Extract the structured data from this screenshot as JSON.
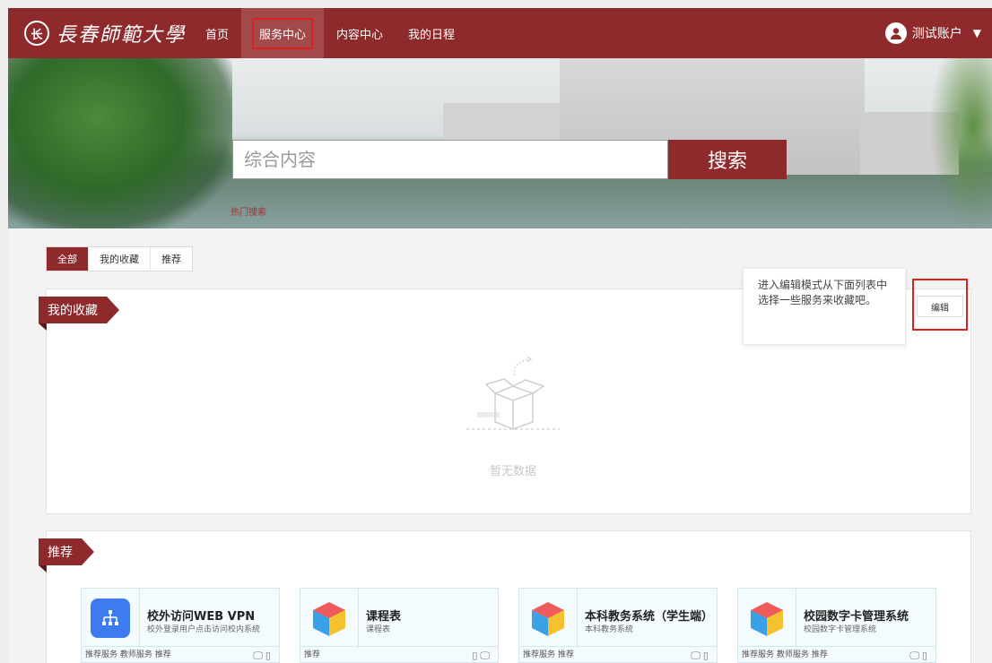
{
  "header": {
    "logo_text": "長春師範大學",
    "logo_seal": "长",
    "nav": [
      {
        "label": "首页"
      },
      {
        "label": "服务中心"
      },
      {
        "label": "内容中心"
      },
      {
        "label": "我的日程"
      }
    ],
    "user_name": "测试账户",
    "caret": "▼",
    "accent": "#8e2a2b"
  },
  "search": {
    "placeholder": "综合内容",
    "button_label": "搜索",
    "hot_label": "热门搜索"
  },
  "filter_tabs": [
    {
      "label": "全部"
    },
    {
      "label": "我的收藏"
    },
    {
      "label": "推荐"
    }
  ],
  "favorites": {
    "title": "我的收藏",
    "empty_text": "暂无数据",
    "tip_text": "进入编辑模式从下面列表中选择一些服务来收藏吧。",
    "edit_label": "编辑"
  },
  "recommend": {
    "title": "推荐",
    "cards": [
      {
        "title": "校外访问WEB VPN",
        "subtitle": "校外登录用户点击访问校内系统",
        "tags": "推荐服务 教师服务 推荐",
        "devices": "🖵▯",
        "icon": "sitemap-icon"
      },
      {
        "title": "课程表",
        "subtitle": "课程表",
        "tags": "推荐",
        "devices": "▯🖵",
        "icon": "cube-icon"
      },
      {
        "title": "本科教务系统（学生端）",
        "subtitle": "本科教务系统",
        "tags": "推荐服务 推荐",
        "devices": "🖵▯",
        "icon": "cube-icon"
      },
      {
        "title": "校园数字卡管理系统",
        "subtitle": "校园数字卡管理系统",
        "tags": "推荐服务 教师服务 推荐",
        "devices": "🖵▯",
        "icon": "cube-icon"
      }
    ]
  }
}
